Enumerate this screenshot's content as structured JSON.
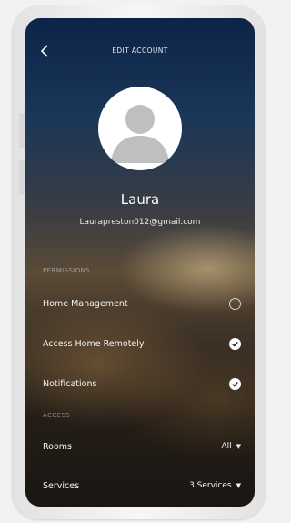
{
  "header": {
    "title": "EDIT ACCOUNT"
  },
  "profile": {
    "name": "Laura",
    "email": "Laurapreston012@gmail.com"
  },
  "permissions": {
    "heading": "PERMISSIONS",
    "items": [
      {
        "label": "Home Management",
        "checked": false
      },
      {
        "label": "Access Home Remotely",
        "checked": true
      },
      {
        "label": "Notifications",
        "checked": true
      }
    ]
  },
  "access": {
    "heading": "ACCESS",
    "rooms": {
      "label": "Rooms",
      "value": "All"
    },
    "services": {
      "label": "Services",
      "value": "3 Services"
    }
  },
  "icons": {
    "back": "chevron-left-icon",
    "avatar": "person-icon",
    "checked": "check-circle-icon",
    "unchecked": "empty-circle-icon",
    "dropdown": "caret-down-icon"
  },
  "colors": {
    "screen_top": "#0c2448",
    "screen_bottom": "#1a1612",
    "text": "#ffffff",
    "avatar_bg": "#ffffff",
    "avatar_figure": "#bfbfbf"
  }
}
